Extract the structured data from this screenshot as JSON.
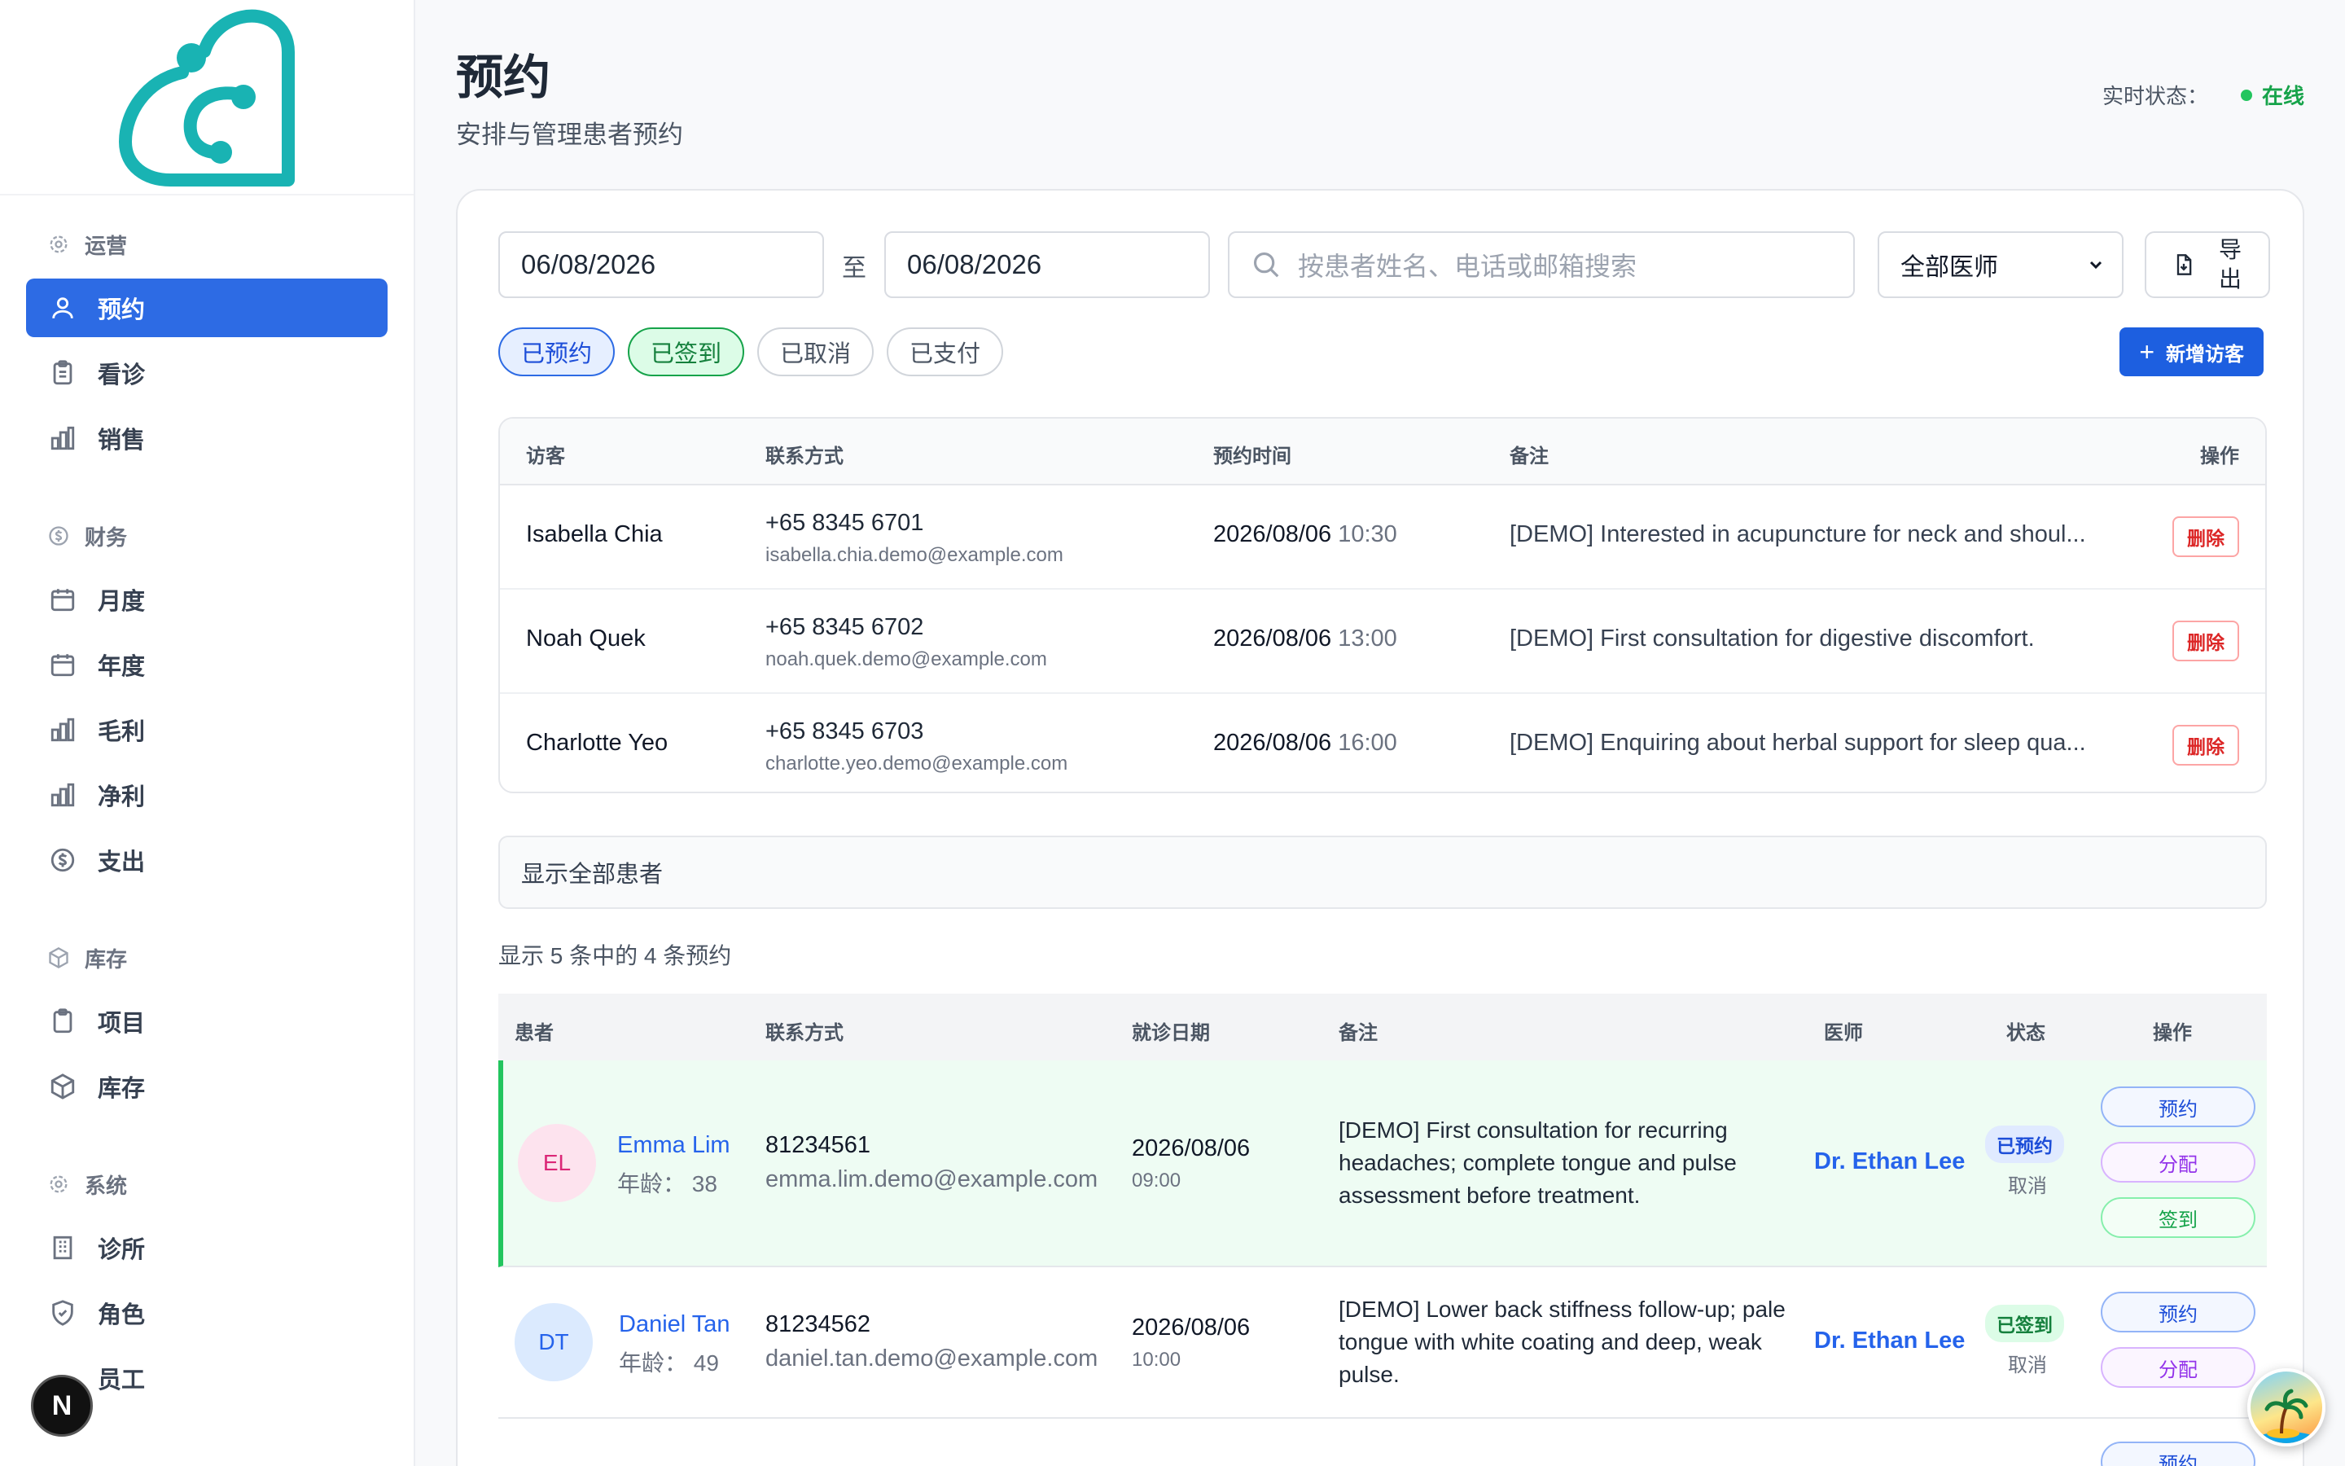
{
  "sidebar": {
    "sections": [
      {
        "title": "运营",
        "items": [
          "预约",
          "看诊",
          "销售"
        ]
      },
      {
        "title": "财务",
        "items": [
          "月度",
          "年度",
          "毛利",
          "净利",
          "支出"
        ]
      },
      {
        "title": "库存",
        "items": [
          "项目",
          "库存"
        ]
      },
      {
        "title": "系统",
        "items": [
          "诊所",
          "角色",
          "员工"
        ]
      }
    ],
    "active_item": "预约",
    "user_initial": "N"
  },
  "header": {
    "title": "预约",
    "subtitle": "安排与管理患者预约",
    "status_label": "实时状态：",
    "status_value": "在线"
  },
  "filters": {
    "date_from": "06/08/2026",
    "date_separator": "至",
    "date_to": "06/08/2026",
    "search_placeholder": "按患者姓名、电话或邮箱搜索",
    "doctor_select": "全部医师",
    "export_label": "导出"
  },
  "chips": [
    "已预约",
    "已签到",
    "已取消",
    "已支付"
  ],
  "add_visitor_label": "新增访客",
  "visitors_table": {
    "headers": [
      "访客",
      "联系方式",
      "预约时间",
      "备注",
      "操作"
    ],
    "rows": [
      {
        "name": "Isabella Chia",
        "phone": "+65 8345 6701",
        "email": "isabella.chia.demo@example.com",
        "date": "2026/08/06",
        "time": "10:30",
        "note": "[DEMO] Interested in acupuncture for neck and shoul...",
        "action": "删除"
      },
      {
        "name": "Noah Quek",
        "phone": "+65 8345 6702",
        "email": "noah.quek.demo@example.com",
        "date": "2026/08/06",
        "time": "13:00",
        "note": "[DEMO] First consultation for digestive discomfort.",
        "action": "删除"
      },
      {
        "name": "Charlotte Yeo",
        "phone": "+65 8345 6703",
        "email": "charlotte.yeo.demo@example.com",
        "date": "2026/08/06",
        "time": "16:00",
        "note": "[DEMO] Enquiring about herbal support for sleep qua...",
        "action": "删除"
      }
    ]
  },
  "show_all_label": "显示全部患者",
  "summary_text": "显示 5 条中的 4 条预约",
  "appointments_table": {
    "headers": [
      "患者",
      "联系方式",
      "就诊日期",
      "备注",
      "医师",
      "状态",
      "操作"
    ],
    "rows": [
      {
        "initials": "EL",
        "name": "Emma Lim",
        "age": "年龄： 38",
        "phone": "81234561",
        "email": "emma.lim.demo@example.com",
        "date": "2026/08/06",
        "time": "09:00",
        "note": "[DEMO] First consultation for recurring headaches; complete tongue and pulse assessment before treatment.",
        "doctor": "Dr. Ethan Lee",
        "status": "已预约",
        "cancel": "取消",
        "actions": [
          "预约",
          "分配",
          "签到"
        ]
      },
      {
        "initials": "DT",
        "name": "Daniel Tan",
        "age": "年龄： 49",
        "phone": "81234562",
        "email": "daniel.tan.demo@example.com",
        "date": "2026/08/06",
        "time": "10:00",
        "note": "[DEMO] Lower back stiffness follow-up; pale tongue with white coating and deep, weak pulse.",
        "doctor": "Dr. Ethan Lee",
        "status": "已签到",
        "cancel": "取消",
        "actions": [
          "预约",
          "分配"
        ]
      },
      {
        "actions": [
          "预约"
        ]
      }
    ]
  },
  "colors": {
    "primary": "#2d6be4",
    "online": "#22c55e",
    "logo": "#19b3b3",
    "delete": "#dc2626",
    "highlight_row": "#eefcf3"
  }
}
